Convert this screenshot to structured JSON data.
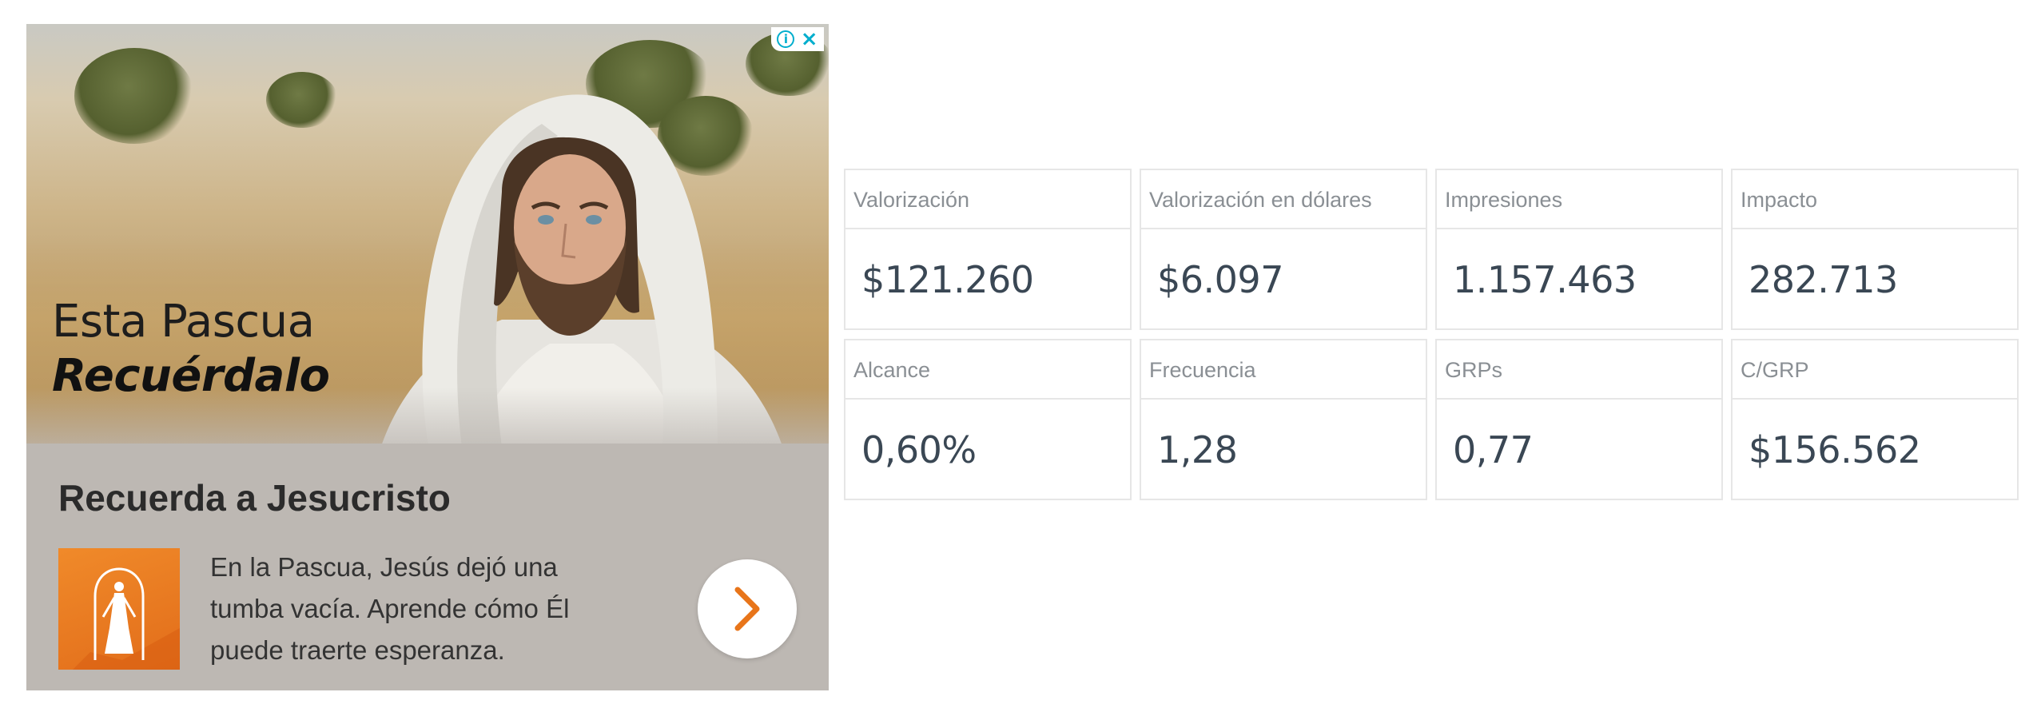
{
  "ad": {
    "headline_line1": "Esta Pascua",
    "headline_line2": "Recuérdalo",
    "title": "Recuerda a Jesucristo",
    "body": "En la Pascua, Jesús dejó una tumba vacía. Aprende cómo Él puede traerte esperanza.",
    "badge_info_icon": "info-icon",
    "badge_close_icon": "close-icon",
    "cta_icon": "chevron-right-icon",
    "colors": {
      "accent": "#00aecd",
      "cta_chevron": "#e8751a",
      "logo_bg": "#e8751a"
    }
  },
  "stats": [
    {
      "label": "Valorización",
      "value": "$121.260"
    },
    {
      "label": "Valorización en dólares",
      "value": "$6.097"
    },
    {
      "label": "Impresiones",
      "value": "1.157.463"
    },
    {
      "label": "Impacto",
      "value": "282.713"
    },
    {
      "label": "Alcance",
      "value": "0,60%"
    },
    {
      "label": "Frecuencia",
      "value": "1,28"
    },
    {
      "label": "GRPs",
      "value": "0,77"
    },
    {
      "label": "C/GRP",
      "value": "$156.562"
    }
  ]
}
